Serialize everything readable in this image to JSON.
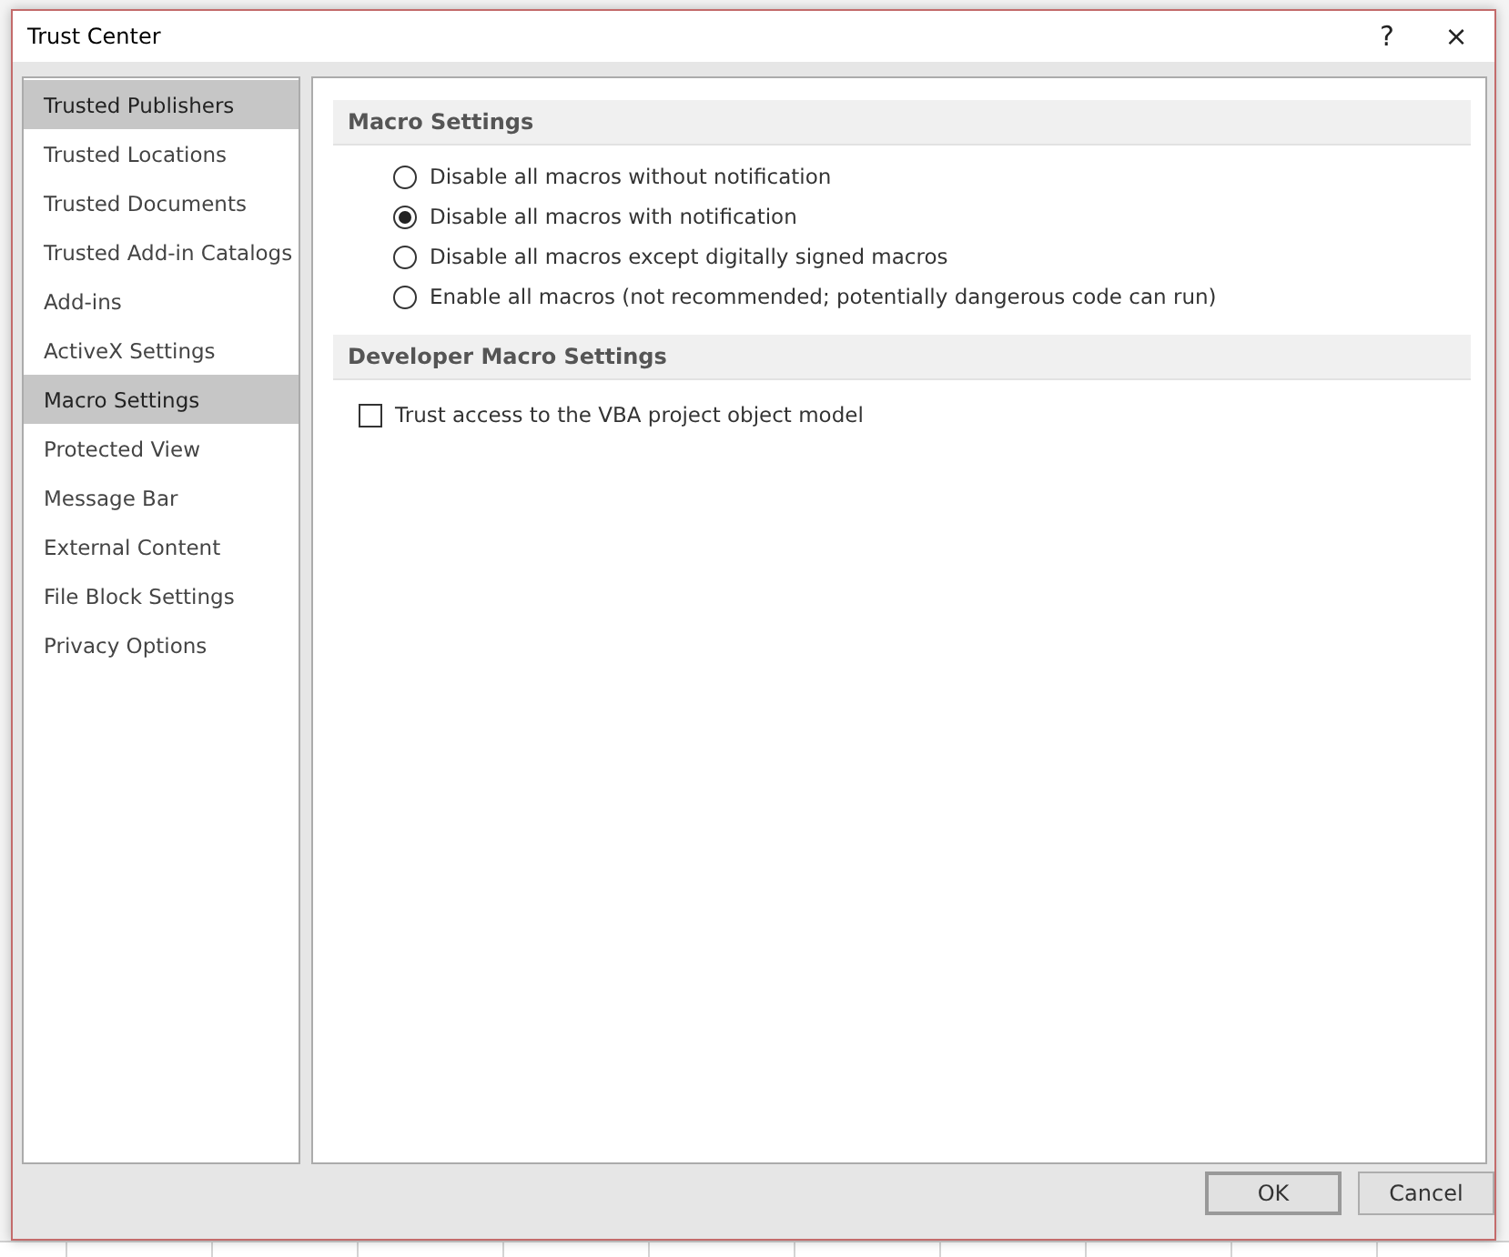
{
  "window": {
    "title": "Trust Center",
    "help": "?",
    "close": "×"
  },
  "sidebar": {
    "items": [
      {
        "label": "Trusted Publishers",
        "selected": true
      },
      {
        "label": "Trusted Locations",
        "selected": false
      },
      {
        "label": "Trusted Documents",
        "selected": false
      },
      {
        "label": "Trusted Add-in Catalogs",
        "selected": false
      },
      {
        "label": "Add-ins",
        "selected": false
      },
      {
        "label": "ActiveX Settings",
        "selected": false
      },
      {
        "label": "Macro Settings",
        "selected": true
      },
      {
        "label": "Protected View",
        "selected": false
      },
      {
        "label": "Message Bar",
        "selected": false
      },
      {
        "label": "External Content",
        "selected": false
      },
      {
        "label": "File Block Settings",
        "selected": false
      },
      {
        "label": "Privacy Options",
        "selected": false
      }
    ]
  },
  "sections": [
    {
      "title": "Macro Settings",
      "options": [
        {
          "kind": "radio",
          "label": "Disable all macros without notification",
          "selected": false
        },
        {
          "kind": "radio",
          "label": "Disable all macros with notification",
          "selected": true
        },
        {
          "kind": "radio",
          "label": "Disable all macros except digitally signed macros",
          "selected": false
        },
        {
          "kind": "radio",
          "label": "Enable all macros (not recommended; potentially dangerous code can run)",
          "selected": false
        }
      ]
    },
    {
      "title": "Developer Macro Settings",
      "options": [
        {
          "kind": "checkbox",
          "label": "Trust access to the VBA project object model",
          "checked": false
        }
      ]
    }
  ],
  "buttons": [
    "OK",
    "Cancel"
  ]
}
